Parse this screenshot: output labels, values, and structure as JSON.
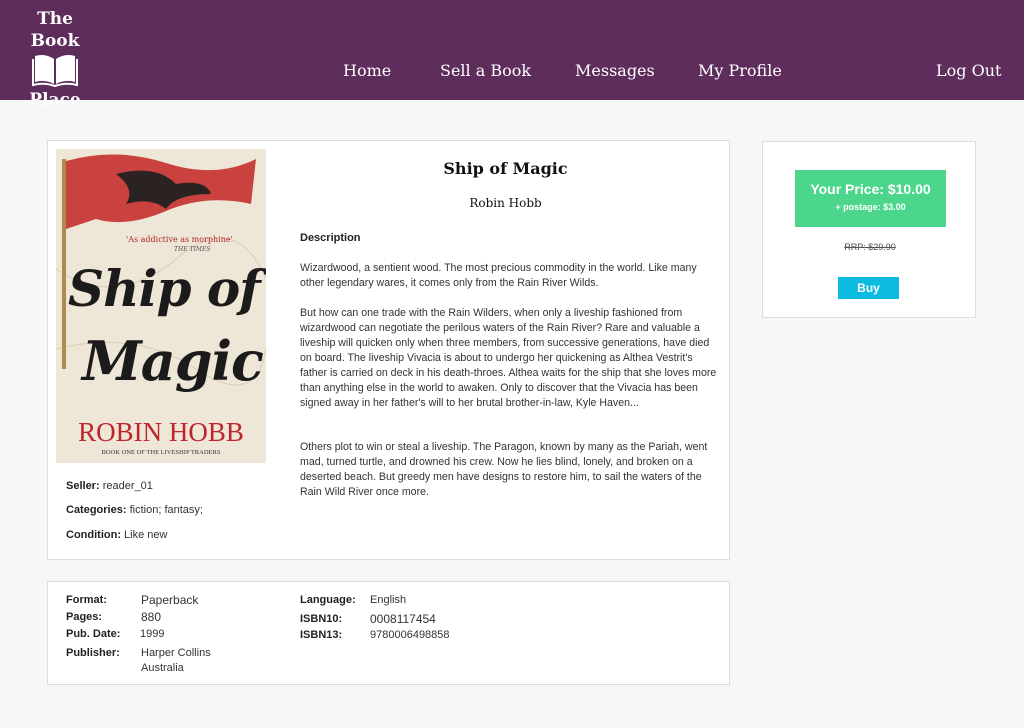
{
  "header": {
    "logo_line1": "The Book",
    "logo_line2": "Place",
    "logo_icon": "open-book-icon",
    "nav": {
      "home": "Home",
      "sell": "Sell a Book",
      "messages": "Messages",
      "profile": "My Profile",
      "logout": "Log Out"
    }
  },
  "book": {
    "title": "Ship of Magic",
    "author": "Robin Hobb",
    "cover": {
      "quote": "'As addictive as morphine'",
      "quote_source": "THE TIMES",
      "title_line1": "Ship of",
      "title_line2": "Magic",
      "author": "ROBIN HOBB",
      "series": "BOOK ONE OF THE LIVESHIP TRADERS"
    },
    "description_heading": "Description",
    "description": [
      "Wizardwood, a sentient wood. The most precious commodity in the world. Like many other legendary wares, it comes only from the Rain River Wilds.",
      "But how can one trade with the Rain Wilders, when only a liveship fashioned from wizardwood can negotiate the perilous waters of the Rain River? Rare and valuable a liveship will quicken only when three members, from successive generations, have died on board. The liveship Vivacia is about to undergo her quickening as Althea Vestrit's father is carried on deck in his death-throes. Althea waits for the ship that she loves more than anything else in the world to awaken. Only to discover that the Vivacia has been signed away in her father's will to her brutal brother-in-law, Kyle Haven...",
      "Others plot to win or steal a liveship. The Paragon, known by many as the Pariah, went mad, turned turtle, and drowned his crew. Now he lies blind, lonely, and broken on a deserted beach. But greedy men have designs to restore him, to sail the waters of the Rain Wild River once more."
    ],
    "seller_label": "Seller:",
    "seller": "reader_01",
    "categories_label": "Categories:",
    "categories": "fiction; fantasy;",
    "condition_label": "Condition:",
    "condition": "Like new"
  },
  "pricing": {
    "price": "Your Price: $10.00",
    "postage": "+ postage: $3.00",
    "rrp": "RRP: $29.90",
    "buy_label": "Buy",
    "colors": {
      "price_box": "#4cd68c",
      "buy_button": "#0bbce0"
    }
  },
  "details": {
    "format_label": "Format:",
    "format": "Paperback",
    "pages_label": "Pages:",
    "pages": "880",
    "pubdate_label": "Pub. Date:",
    "pubdate": "1999",
    "publisher_label": "Publisher:",
    "publisher_line1": "Harper Collins",
    "publisher_line2": "Australia",
    "language_label": "Language:",
    "language": "English",
    "isbn10_label": "ISBN10:",
    "isbn10": "0008117454",
    "isbn13_label": "ISBN13:",
    "isbn13": "9780006498858"
  },
  "colors": {
    "header": "#5e2d5c",
    "background": "#f7f7f7"
  }
}
